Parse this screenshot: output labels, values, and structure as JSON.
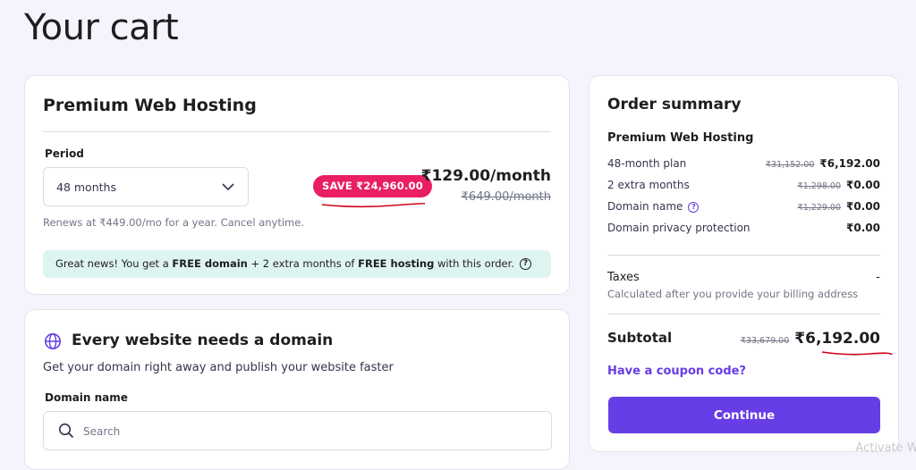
{
  "page": {
    "title": "Your cart"
  },
  "hosting": {
    "title": "Premium Web Hosting",
    "period_label": "Period",
    "period_value": "48 months",
    "save_badge": "SAVE ₹24,960.00",
    "price": "₹129.00/month",
    "old_price": "₹649.00/month",
    "renews_text": "Renews at ₹449.00/mo for a year. Cancel anytime.",
    "promo": {
      "part1": "Great news! You get a ",
      "bold1": "FREE domain",
      "part2": " + 2 extra months of ",
      "bold2": "FREE hosting",
      "part3": " with this order."
    }
  },
  "domain": {
    "title": "Every website needs a domain",
    "subtitle": "Get your domain right away and publish your website faster",
    "field_label": "Domain name",
    "search_placeholder": "Search"
  },
  "summary": {
    "title": "Order summary",
    "product": "Premium Web Hosting",
    "rows": [
      {
        "label": "48-month plan",
        "old": "₹31,152.00",
        "value": "₹6,192.00"
      },
      {
        "label": "2 extra months",
        "old": "₹1,298.00",
        "value": "₹0.00"
      },
      {
        "label": "Domain name",
        "old": "₹1,229.00",
        "value": "₹0.00"
      },
      {
        "label": "Domain privacy protection",
        "old": "",
        "value": "₹0.00"
      }
    ],
    "taxes_label": "Taxes",
    "taxes_value": "-",
    "taxes_note": "Calculated after you provide your billing address",
    "subtotal_label": "Subtotal",
    "subtotal_old": "₹33,679.00",
    "subtotal_value": "₹6,192.00",
    "coupon_link": "Have a coupon code?",
    "continue_label": "Continue"
  },
  "colors": {
    "accent": "#673de6",
    "badge": "#e91e63",
    "promo_bg": "#def4f0",
    "annotation": "#d0021b"
  },
  "watermark": "Activate Wi"
}
